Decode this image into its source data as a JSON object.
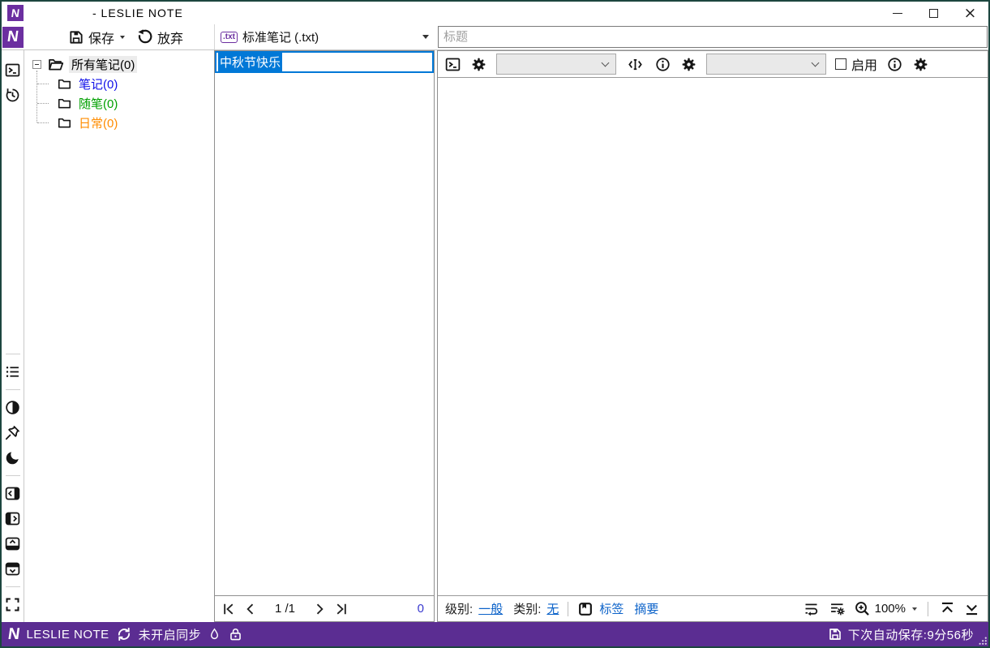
{
  "window": {
    "title": "- LESLIE NOTE"
  },
  "toolbar": {
    "save_label": "保存",
    "discard_label": "放弃"
  },
  "note_type": {
    "badge": ".txt",
    "label": "标准笔记 (.txt)"
  },
  "tree": {
    "root_label": "所有笔记(0)",
    "items": [
      {
        "label": "笔记(0)",
        "color": "#0f0fe8"
      },
      {
        "label": "随笔(0)",
        "color": "#00a000"
      },
      {
        "label": "日常(0)",
        "color": "#ff8c00"
      }
    ]
  },
  "note_list": {
    "items": [
      {
        "title": "中秋节快乐",
        "selected": true
      }
    ]
  },
  "pagination": {
    "page_text": "1 /1",
    "count": "0"
  },
  "editor": {
    "title_placeholder": "标题",
    "enable_label": "启用",
    "zoom_level": "100%"
  },
  "footer": {
    "level_label": "级别:",
    "level_value": "一般",
    "category_label": "类别:",
    "category_value": "无",
    "tags_label": "标签",
    "summary_label": "摘要"
  },
  "statusbar": {
    "app_name": "LESLIE NOTE",
    "sync_status": "未开启同步",
    "autosave": "下次自动保存:9分56秒"
  },
  "colors": {
    "window_border": "#1c463f",
    "logo_purple": "#6b2fa0",
    "statusbar_purple": "#5b2d92",
    "selection_blue": "#0078d7",
    "link_blue": "#0b62c9",
    "tree_blue": "#0f0fe8",
    "tree_green": "#00a000",
    "tree_orange": "#ff8c00",
    "count_blue": "#3939cf"
  },
  "icons": [
    "app-logo",
    "save-floppy",
    "undo",
    "txt-badge",
    "terminal",
    "history",
    "list",
    "contrast",
    "pin",
    "moon",
    "collapse-left-panel",
    "collapse-right-panel",
    "collapse-top-panel",
    "collapse-bottom-panel",
    "fullscreen",
    "gear",
    "text-cursor",
    "info",
    "checkbox",
    "folder-open",
    "folder",
    "first-page",
    "prev-page",
    "next-page",
    "last-page",
    "bookmark",
    "word-wrap",
    "list-settings",
    "zoom-in",
    "scroll-to-top",
    "scroll-to-bottom",
    "sync",
    "ink-drop",
    "lock",
    "resize-grip",
    "minimize",
    "maximize",
    "close"
  ]
}
